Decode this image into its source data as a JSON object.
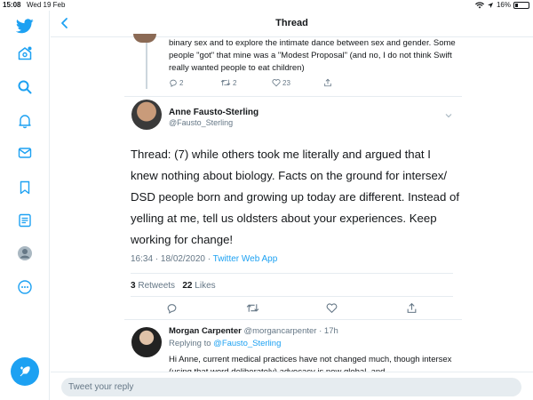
{
  "status_bar": {
    "time": "15:08",
    "date": "Wed 19 Feb",
    "battery": "16%"
  },
  "header": {
    "title": "Thread"
  },
  "sidebar": {
    "items": [
      "twitter-logo",
      "home",
      "search",
      "notifications",
      "messages",
      "bookmarks",
      "lists",
      "profile",
      "more"
    ]
  },
  "previous_tweet": {
    "text": "binary sex and to explore the intimate dance between sex and gender. Some people \"got\" that mine was a \"Modest Proposal\" (and no, I do not think Swift really wanted people to eat children)",
    "replies": "2",
    "retweets": "2",
    "likes": "23"
  },
  "main_tweet": {
    "name": "Anne Fausto-Sterling",
    "handle": "@Fausto_Sterling",
    "text": "Thread: (7) while others took me literally and argued that I knew nothing about biology. Facts on the ground for intersex/ DSD people born and growing up today are different. Instead of yelling at me, tell us oldsters about your experiences. Keep working for change!",
    "time": "16:34 · 18/02/2020 · ",
    "source": "Twitter Web App",
    "retweets_count": "3",
    "retweets_label": "Retweets",
    "likes_count": "22",
    "likes_label": "Likes"
  },
  "reply": {
    "name": "Morgan Carpenter",
    "handle": "@morgancarpenter",
    "time": "· 17h",
    "replying_label": "Replying to ",
    "replying_to": "@Fausto_Sterling",
    "text": "Hi Anne, current medical practices have not changed much, though intersex (using that word deliberately) advocacy is now global, and"
  },
  "compose": {
    "placeholder": "Tweet your reply"
  },
  "colors": {
    "accent": "#1da1f2",
    "muted": "#657786",
    "divider": "#e6ecf0"
  }
}
